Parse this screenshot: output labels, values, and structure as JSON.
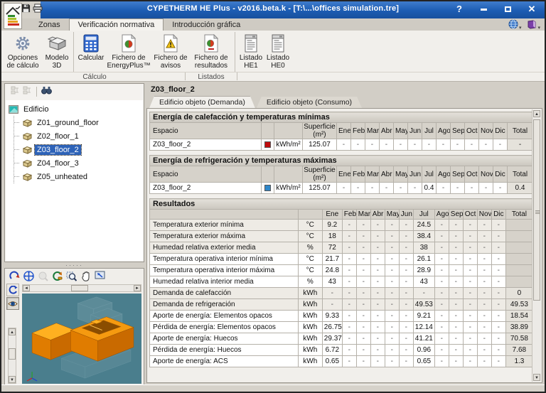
{
  "window": {
    "title": "CYPETHERM HE Plus - v2016.beta.k - [T:\\...\\offices simulation.tre]",
    "help": "?"
  },
  "ribbon": {
    "tabs": [
      {
        "label": "Zonas",
        "active": false
      },
      {
        "label": "Verificación normativa",
        "active": true
      },
      {
        "label": "Introducción gráfica",
        "active": false
      }
    ],
    "buttons": [
      {
        "label": "Opciones de cálculo",
        "icon": "gear-icon"
      },
      {
        "label": "Modelo 3D",
        "icon": "box-3d-icon"
      },
      {
        "label": "Calcular",
        "icon": "calculator-icon"
      },
      {
        "label": "Fichero de EnergyPlus™",
        "icon": "file-energyplus-icon"
      },
      {
        "label": "Fichero de avisos",
        "icon": "file-warning-icon"
      },
      {
        "label": "Fichero de resultados",
        "icon": "file-results-icon"
      },
      {
        "label": "Listado HE1",
        "icon": "report-icon"
      },
      {
        "label": "Listado HE0",
        "icon": "report-icon"
      }
    ],
    "groups": [
      {
        "label": "Cálculo"
      },
      {
        "label": "Listados"
      }
    ]
  },
  "tree": {
    "root": "Edificio",
    "items": [
      "Z01_ground_floor",
      "Z02_floor_1",
      "Z03_floor_2",
      "Z04_floor_3",
      "Z05_unheated"
    ],
    "selected": "Z03_floor_2",
    "selected_index": 2
  },
  "main": {
    "title": "Z03_floor_2",
    "tabs": [
      "Edificio objeto (Demanda)",
      "Edificio objeto (Consumo)"
    ],
    "months": [
      "Ene",
      "Feb",
      "Mar",
      "Abr",
      "May",
      "Jun",
      "Jul",
      "Ago",
      "Sep",
      "Oct",
      "Nov",
      "Dic"
    ],
    "cols": {
      "espacio": "Espacio",
      "superficie": "Superficie (m²)",
      "total": "Total"
    },
    "heating": {
      "title": "Energía de calefacción y temperaturas mínimas",
      "row": {
        "espacio": "Z03_floor_2",
        "color": "#c00c0c",
        "unit": "kWh/m²",
        "superficie": "125.07",
        "values": [
          "-",
          "-",
          "-",
          "-",
          "-",
          "-",
          "-",
          "-",
          "-",
          "-",
          "-",
          "-"
        ],
        "total": "-"
      }
    },
    "cooling": {
      "title": "Energía de refrigeración y temperaturas máximas",
      "row": {
        "espacio": "Z03_floor_2",
        "color": "#2f87c9",
        "unit": "kWh/m²",
        "superficie": "125.07",
        "values": [
          "-",
          "-",
          "-",
          "-",
          "-",
          "-",
          "0.4",
          "-",
          "-",
          "-",
          "-",
          "-"
        ],
        "total": "0.4"
      }
    },
    "results": {
      "title": "Resultados",
      "rows": [
        {
          "label": "Temperatura exterior mínima",
          "unit": "°C",
          "values": [
            "9.2",
            "-",
            "-",
            "-",
            "-",
            "-",
            "24.5",
            "-",
            "-",
            "-",
            "-",
            "-"
          ],
          "total": "",
          "tint": true
        },
        {
          "label": "Temperatura exterior máxima",
          "unit": "°C",
          "values": [
            "18",
            "-",
            "-",
            "-",
            "-",
            "-",
            "38.4",
            "-",
            "-",
            "-",
            "-",
            "-"
          ],
          "total": "",
          "tint": true
        },
        {
          "label": "Humedad relativa exterior media",
          "unit": "%",
          "values": [
            "72",
            "-",
            "-",
            "-",
            "-",
            "-",
            "38",
            "-",
            "-",
            "-",
            "-",
            "-"
          ],
          "total": "",
          "tint": true
        },
        {
          "label": "Temperatura operativa interior mínima",
          "unit": "°C",
          "values": [
            "21.7",
            "-",
            "-",
            "-",
            "-",
            "-",
            "26.1",
            "-",
            "-",
            "-",
            "-",
            "-"
          ],
          "total": "",
          "tint": false
        },
        {
          "label": "Temperatura operativa interior máxima",
          "unit": "°C",
          "values": [
            "24.8",
            "-",
            "-",
            "-",
            "-",
            "-",
            "28.9",
            "-",
            "-",
            "-",
            "-",
            "-"
          ],
          "total": "",
          "tint": false
        },
        {
          "label": "Humedad relativa interior media",
          "unit": "%",
          "values": [
            "43",
            "-",
            "-",
            "-",
            "-",
            "-",
            "43",
            "-",
            "-",
            "-",
            "-",
            "-"
          ],
          "total": "",
          "tint": false
        },
        {
          "label": "Demanda de calefacción",
          "unit": "kWh",
          "values": [
            "-",
            "-",
            "-",
            "-",
            "-",
            "-",
            "-",
            "-",
            "-",
            "-",
            "-",
            "-"
          ],
          "total": "0",
          "tint": true
        },
        {
          "label": "Demanda de refrigeración",
          "unit": "kWh",
          "values": [
            "-",
            "-",
            "-",
            "-",
            "-",
            "-",
            "49.53",
            "-",
            "-",
            "-",
            "-",
            "-"
          ],
          "total": "49.53",
          "tint": true
        },
        {
          "label": "Aporte de energía: Elementos opacos",
          "unit": "kWh",
          "values": [
            "9.33",
            "-",
            "-",
            "-",
            "-",
            "-",
            "9.21",
            "-",
            "-",
            "-",
            "-",
            "-"
          ],
          "total": "18.54",
          "tint": false
        },
        {
          "label": "Pérdida de energía: Elementos opacos",
          "unit": "kWh",
          "values": [
            "26.75",
            "-",
            "-",
            "-",
            "-",
            "-",
            "12.14",
            "-",
            "-",
            "-",
            "-",
            "-"
          ],
          "total": "38.89",
          "tint": false
        },
        {
          "label": "Aporte de energía: Huecos",
          "unit": "kWh",
          "values": [
            "29.37",
            "-",
            "-",
            "-",
            "-",
            "-",
            "41.21",
            "-",
            "-",
            "-",
            "-",
            "-"
          ],
          "total": "70.58",
          "tint": false
        },
        {
          "label": "Pérdida de energía: Huecos",
          "unit": "kWh",
          "values": [
            "6.72",
            "-",
            "-",
            "-",
            "-",
            "-",
            "0.96",
            "-",
            "-",
            "-",
            "-",
            "-"
          ],
          "total": "7.68",
          "tint": false
        },
        {
          "label": "Aporte de energía: ACS",
          "unit": "kWh",
          "values": [
            "0.65",
            "-",
            "-",
            "-",
            "-",
            "-",
            "0.65",
            "-",
            "-",
            "-",
            "-",
            "-"
          ],
          "total": "1.3",
          "tint": false
        }
      ]
    }
  },
  "icons": [
    "energy-house",
    "save-floppy",
    "printer",
    "globe-help",
    "book-help",
    "binoculars-search",
    "rotate-view",
    "zoom-extents",
    "orbit",
    "zoom-window",
    "pan-hand",
    "fullscreen",
    "spin-model",
    "visibility-eye"
  ],
  "colors": {
    "titlebar": "#1c5cb2",
    "viewport_bg": "#4a7e8d",
    "model_orange": "#f08c00",
    "heating_swatch": "#c00c0c",
    "cooling_swatch": "#2f87c9"
  }
}
